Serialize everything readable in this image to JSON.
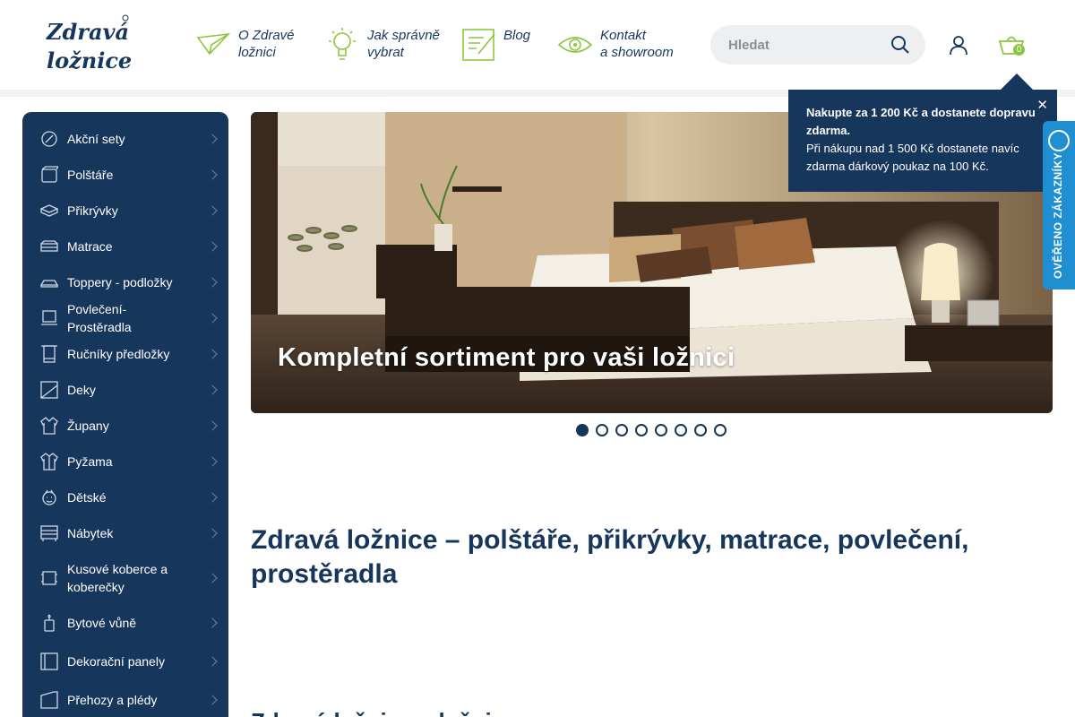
{
  "header": {
    "logo_text": "Zdravá ložnice",
    "nav": [
      {
        "label": "O Zdravé\nložnici",
        "icon": "paper-plane-icon"
      },
      {
        "label": "Jak správně\nvybrat",
        "icon": "lightbulb-icon"
      },
      {
        "label": "Blog",
        "icon": "notepad-pencil-icon"
      },
      {
        "label": "Kontakt\na showroom",
        "icon": "eye-icon"
      }
    ],
    "search_placeholder": "Hledat",
    "cart_count": "0"
  },
  "sidebar": {
    "items": [
      {
        "label": "Akční sety",
        "icon": "badge-icon"
      },
      {
        "label": "Polštáře",
        "icon": "pillow-icon"
      },
      {
        "label": "Přikrývky",
        "icon": "duvet-icon"
      },
      {
        "label": "Matrace",
        "icon": "mattress-icon"
      },
      {
        "label": "Toppery - podložky",
        "icon": "topper-icon"
      },
      {
        "label": "Povlečení- Prostěradla",
        "icon": "bedding-icon"
      },
      {
        "label": "Ručníky předložky",
        "icon": "towel-icon"
      },
      {
        "label": "Deky",
        "icon": "blanket-icon"
      },
      {
        "label": "Župany",
        "icon": "bathrobe-icon"
      },
      {
        "label": "Pyžama",
        "icon": "pajamas-icon"
      },
      {
        "label": "Dětské",
        "icon": "kids-icon"
      },
      {
        "label": "Nábytek",
        "icon": "furniture-icon"
      },
      {
        "label": "Kusové koberce a koberečky",
        "icon": "rug-icon"
      },
      {
        "label": "Bytové vůně",
        "icon": "candle-icon"
      },
      {
        "label": "Dekorační panely",
        "icon": "panel-icon"
      },
      {
        "label": "Přehozy a plédy",
        "icon": "throw-icon"
      }
    ]
  },
  "hero": {
    "caption": "Kompletní sortiment pro vaši ložnici",
    "slide_count": 8,
    "active_slide": 1
  },
  "main": {
    "heading": "Zdravá ložnice – polštáře, přikrývky, matrace, povlečení, prostěradla",
    "subheading": "Zdravá ložnice – ložnice"
  },
  "popup": {
    "line1": "Nakupte za 1 200 Kč a dostanete dopravu zdarma.",
    "line2": "Při nákupu nad 1 500 Kč dostanete navíc zdarma dárkový poukaz na 100 Kč.",
    "close": "✕"
  },
  "badge": {
    "text": "OVĚŘENO ZÁKAZNÍKY"
  },
  "colors": {
    "brand_navy": "#16365c",
    "brand_green": "#8cc63f",
    "badge_blue": "#1f8fd1"
  }
}
